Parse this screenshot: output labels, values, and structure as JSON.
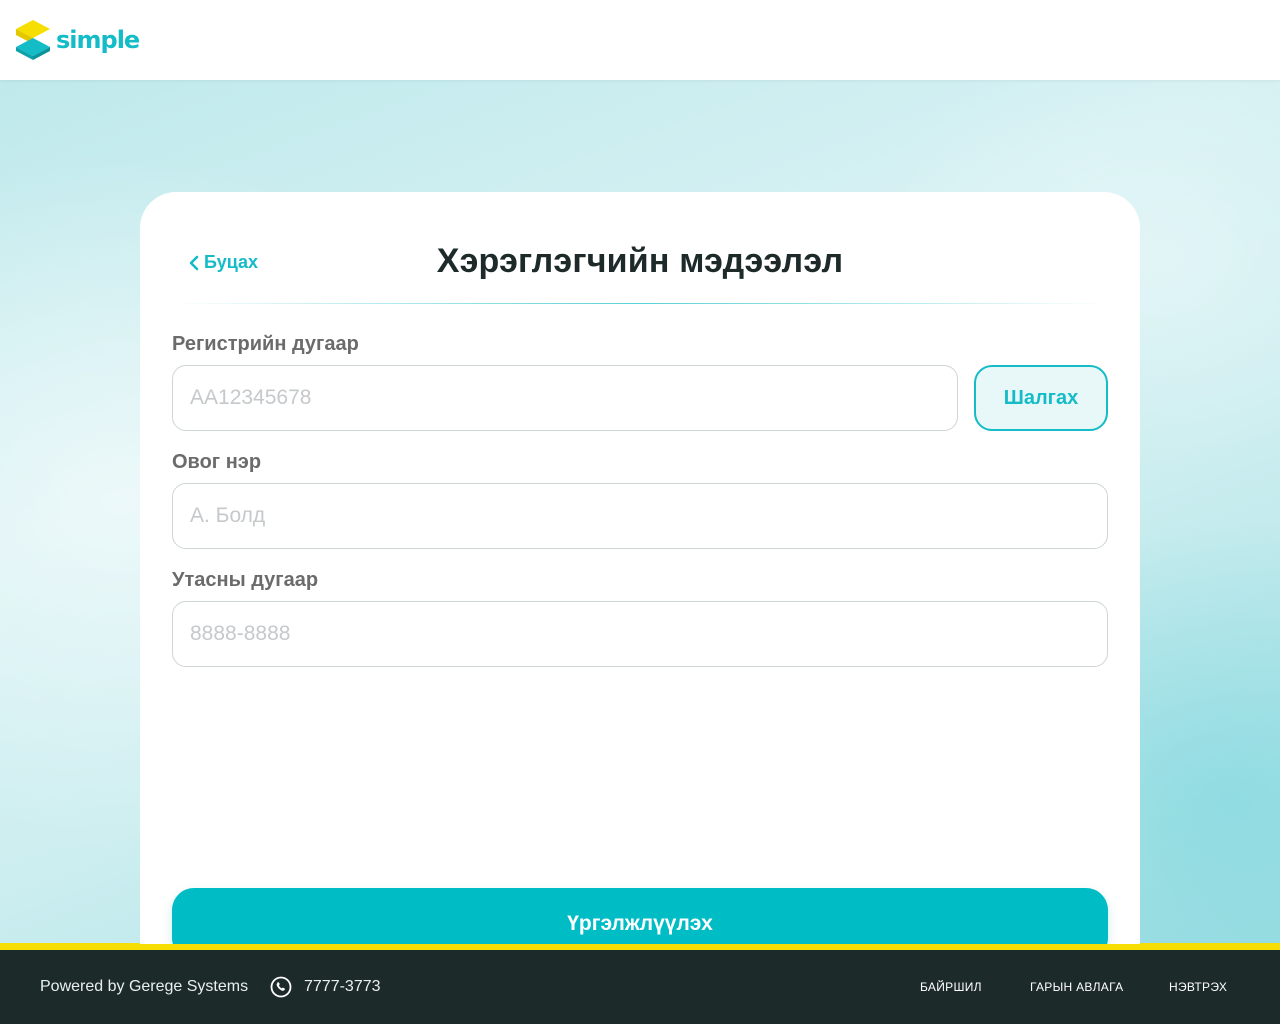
{
  "brand": {
    "logo_text": "simple",
    "accent_color": "#13bcc6",
    "logo_yellow": "#f6df00"
  },
  "card": {
    "back_label": "Буцах",
    "title": "Хэрэглэгчийн мэдээлэл"
  },
  "form": {
    "registration": {
      "label": "Регистрийн дугаар",
      "placeholder": "АА12345678",
      "value": ""
    },
    "check_button_label": "Шалгах",
    "full_name": {
      "label": "Овог нэр",
      "placeholder": "А. Болд",
      "value": ""
    },
    "phone": {
      "label": "Утасны дугаар",
      "placeholder": "8888-8888",
      "value": ""
    },
    "continue_button_label": "Үргэлжлүүлэх"
  },
  "footer": {
    "powered_by": "Powered by Gerege Systems",
    "phone_number": "7777-3773",
    "links": [
      "БАЙРШИЛ",
      "ГАРЫН АВЛАГА",
      "НЭВТРЭХ"
    ],
    "background_color": "#1d2a2a",
    "stripe_color": "#f6df00"
  }
}
